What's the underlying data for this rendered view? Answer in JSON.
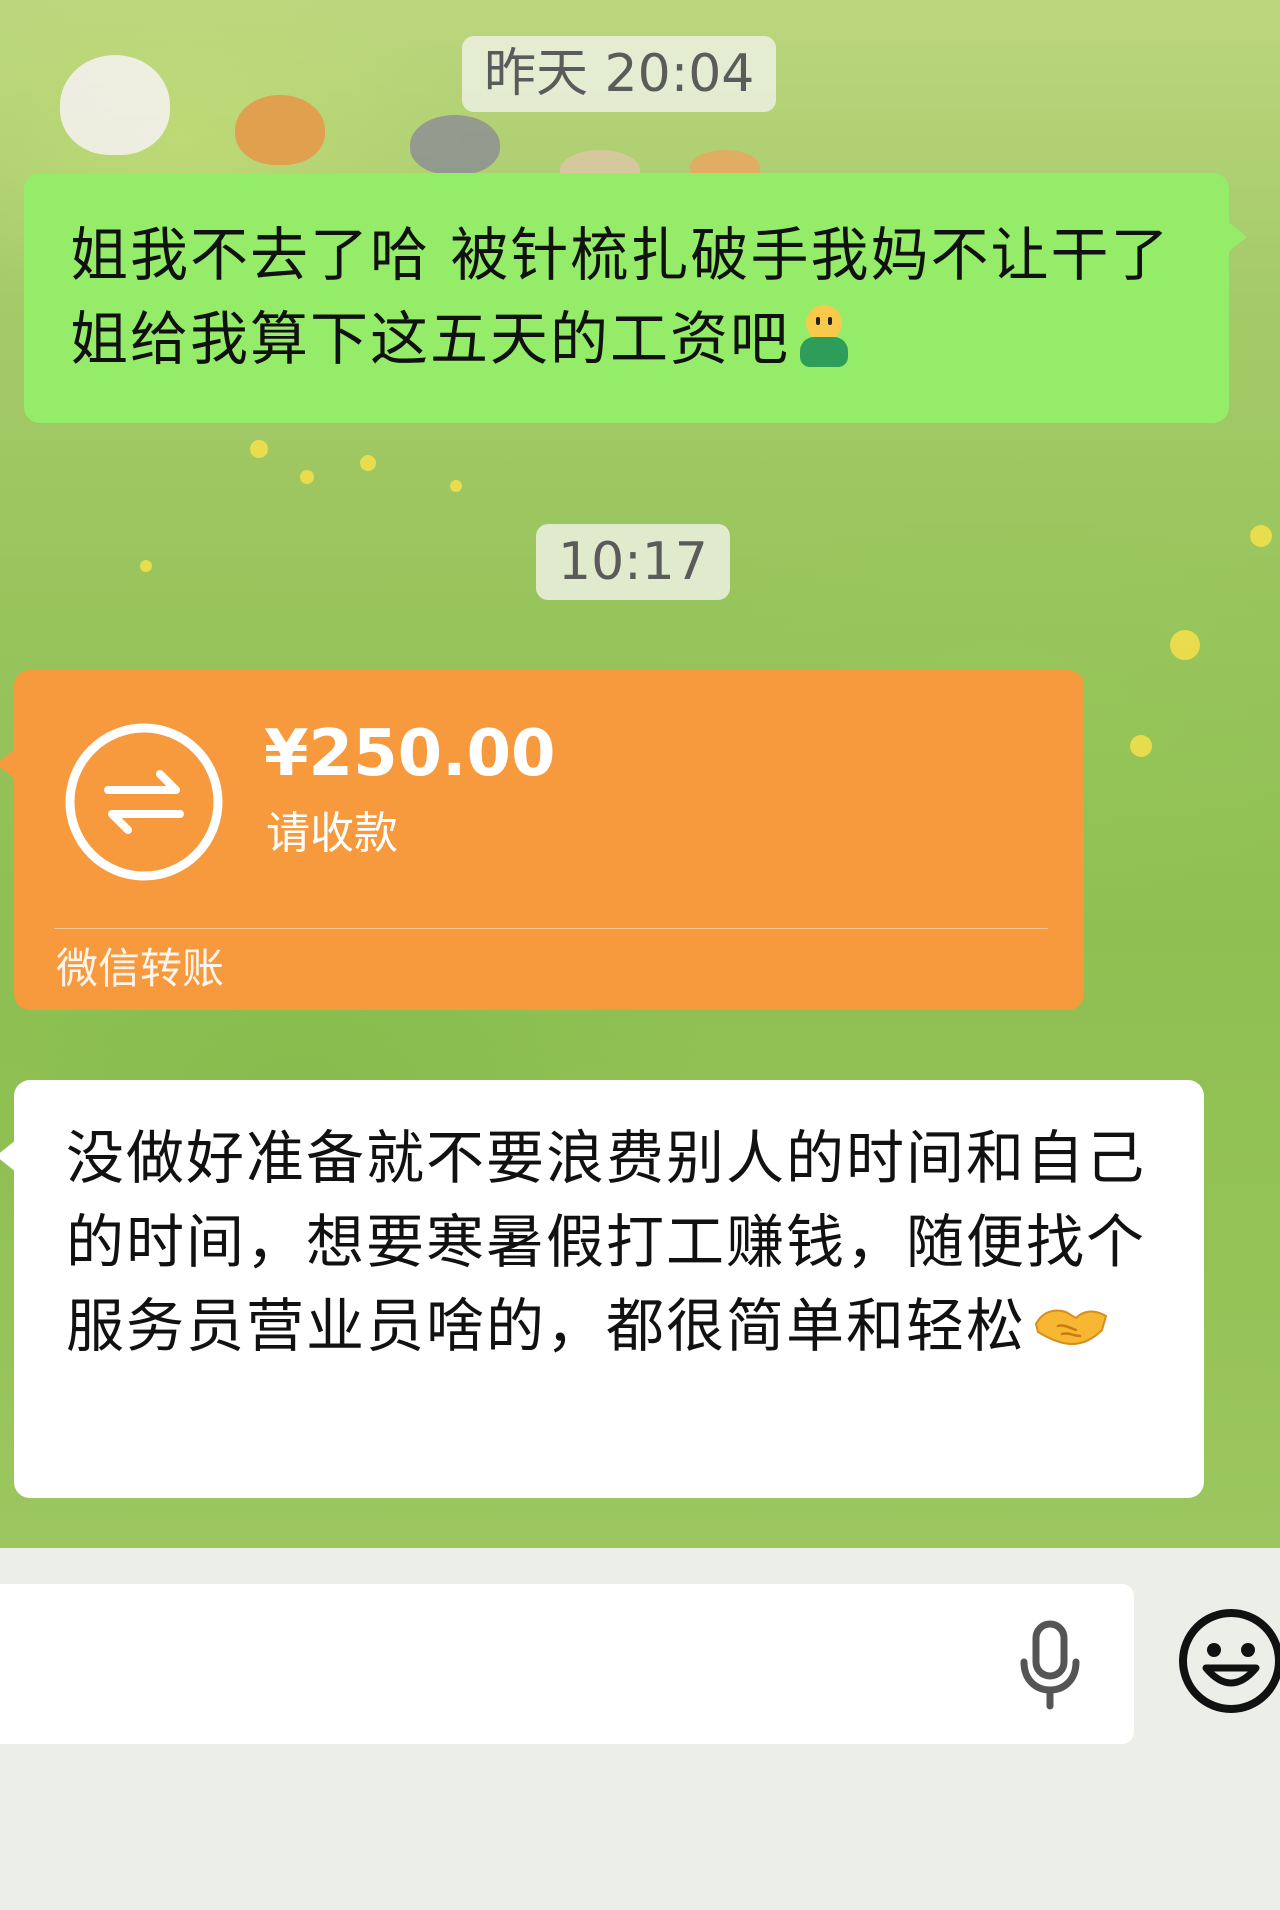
{
  "chat": {
    "timestamps": {
      "first": "昨天 20:04",
      "second": "10:17"
    },
    "messages": [
      {
        "side": "right",
        "text": "姐我不去了哈 被针梳扎破手我妈不让干了 姐给我算下这五天的工资吧",
        "trailing_emoji": "person-emoji"
      },
      {
        "side": "left",
        "type": "transfer",
        "amount": "¥250.00",
        "status": "请收款",
        "footer": "微信转账"
      },
      {
        "side": "left",
        "text": "没做好准备就不要浪费别人的时间和自己的时间，想要寒暑假打工赚钱，随便找个服务员营业员啥的，都很简单和轻松",
        "trailing_emoji": "handshake-emoji"
      }
    ]
  },
  "input_bar": {
    "icons": [
      "mic-icon",
      "smile-icon"
    ]
  },
  "colors": {
    "my_bubble": "#95ec69",
    "other_bubble": "#ffffff",
    "transfer_card": "#f79a3d"
  }
}
